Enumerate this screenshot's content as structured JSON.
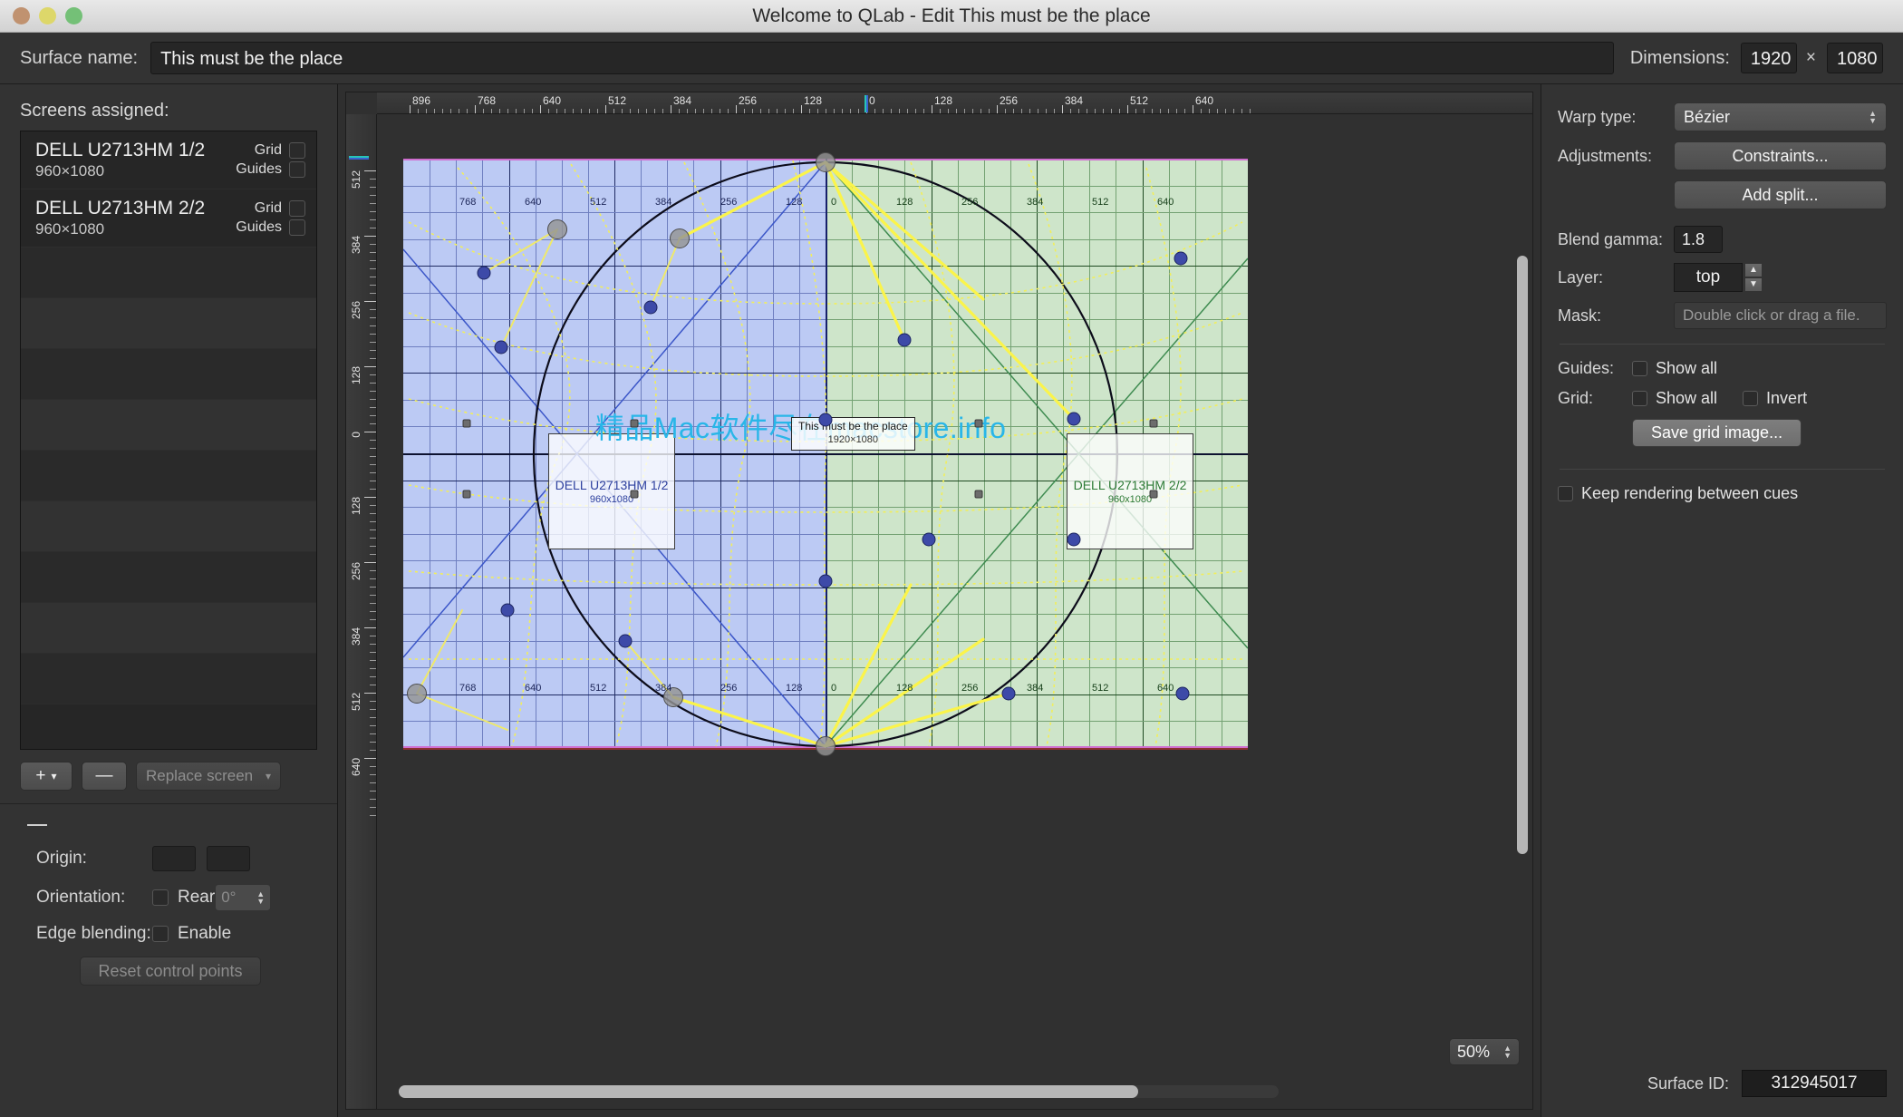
{
  "window": {
    "title": "Welcome to QLab - Edit This must be the place"
  },
  "topbar": {
    "surface_name_label": "Surface name:",
    "surface_name_value": "This must be the place",
    "dimensions_label": "Dimensions:",
    "width": "1920",
    "times": "×",
    "height": "1080"
  },
  "sidebar": {
    "screens_label": "Screens assigned:",
    "screens": [
      {
        "name": "DELL U2713HM 1/2",
        "resolution": "960×1080",
        "grid_label": "Grid",
        "guides_label": "Guides"
      },
      {
        "name": "DELL U2713HM 2/2",
        "resolution": "960×1080",
        "grid_label": "Grid",
        "guides_label": "Guides"
      }
    ],
    "add_label": "+",
    "remove_label": "—",
    "replace_label": "Replace screen",
    "origin_label": "Origin:",
    "origin_x": "",
    "origin_y": "",
    "orientation_label": "Orientation:",
    "rear_label": "Rear",
    "rotation_value": "0°",
    "edge_blending_label": "Edge blending:",
    "enable_label": "Enable",
    "reset_label": "Reset control points"
  },
  "inspector": {
    "warp_type_label": "Warp type:",
    "warp_type_value": "Bézier",
    "adjustments_label": "Adjustments:",
    "constraints_label": "Constraints...",
    "add_split_label": "Add split...",
    "blend_gamma_label": "Blend gamma:",
    "blend_gamma_value": "1.8",
    "layer_label": "Layer:",
    "layer_value": "top",
    "mask_label": "Mask:",
    "mask_placeholder": "Double click or drag a file.",
    "guides_label": "Guides:",
    "guides_show_all": "Show all",
    "grid_label": "Grid:",
    "grid_show_all": "Show all",
    "grid_invert": "Invert",
    "save_grid_label": "Save grid image...",
    "keep_rendering_label": "Keep rendering between cues",
    "surface_id_label": "Surface ID:",
    "surface_id_value": "312945017"
  },
  "canvas": {
    "zoom_value": "50%",
    "watermark": "精品Mac软件尽在macstore.info",
    "selection_label": "This must be the place",
    "selection_size": "1920×1080",
    "left_screen_name": "DELL U2713HM 1/2",
    "left_screen_res": "960x1080",
    "right_screen_name": "DELL U2713HM 2/2",
    "right_screen_res": "960x1080",
    "ruler_h_ticks": [
      "896",
      "768",
      "640",
      "512",
      "384",
      "256",
      "128",
      "0",
      "128",
      "256",
      "384",
      "512",
      "640"
    ],
    "ruler_v_ticks": [
      "512",
      "384",
      "256",
      "128",
      "0",
      "128",
      "256",
      "384",
      "512",
      "640"
    ],
    "inner_h_ticks_left": [
      "768",
      "640",
      "512",
      "384",
      "256",
      "128"
    ],
    "inner_h_ticks_right": [
      "0",
      "128",
      "256",
      "384",
      "512",
      "640"
    ],
    "colors": {
      "left_fill": "#bccaf4",
      "right_fill": "#cee5ca",
      "warp_guide": "#f2ee5a",
      "control_point": "#3d4aa8",
      "edge": "#d06fd0",
      "watermark": "#29b6e8"
    }
  }
}
